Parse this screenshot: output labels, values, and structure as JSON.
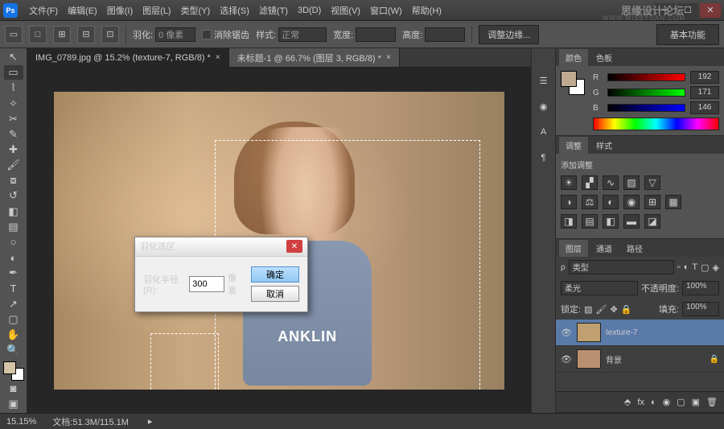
{
  "watermark": {
    "line1": "思缘设计论坛",
    "line2": "WWW.MISSYUAN.COM"
  },
  "menu": {
    "file": "文件(F)",
    "edit": "编辑(E)",
    "image": "图像(I)",
    "layer": "图层(L)",
    "type": "类型(Y)",
    "select": "选择(S)",
    "filter": "滤镜(T)",
    "3d": "3D(D)",
    "view": "视图(V)",
    "window": "窗口(W)",
    "help": "帮助(H)"
  },
  "options": {
    "feather_label": "羽化:",
    "feather_value": "0 像素",
    "antialias": "消除锯齿",
    "style_label": "样式:",
    "style_value": "正常",
    "width_label": "宽度:",
    "height_label": "高度:",
    "refine": "调整边缘...",
    "workspace": "基本功能"
  },
  "tabs": [
    {
      "label": "IMG_0789.jpg @ 15.2% (texture-7, RGB/8) *",
      "active": true
    },
    {
      "label": "未标题-1 @ 66.7% (图层 3, RGB/8) *",
      "active": false
    }
  ],
  "dialog": {
    "title": "羽化选区",
    "radius_label": "羽化半径(R):",
    "radius_value": "300",
    "unit": "像素",
    "ok": "确定",
    "cancel": "取消"
  },
  "vest_text": "ANKLIN",
  "panels": {
    "color": {
      "tab1": "颜色",
      "tab2": "色板",
      "r": "R",
      "g": "G",
      "b": "B",
      "r_val": "192",
      "g_val": "171",
      "b_val": "146"
    },
    "adjust": {
      "tab1": "调整",
      "tab2": "样式",
      "title": "添加调整"
    },
    "layers": {
      "tab1": "图层",
      "tab2": "通道",
      "tab3": "路径",
      "kind": "类型",
      "blend": "柔光",
      "opacity_label": "不透明度:",
      "opacity": "100%",
      "lock_label": "锁定:",
      "fill_label": "填充:",
      "fill": "100%",
      "items": [
        {
          "name": "texture-7",
          "active": true,
          "locked": false
        },
        {
          "name": "背景",
          "active": false,
          "locked": true
        }
      ]
    }
  },
  "status": {
    "zoom": "15.15%",
    "doc": "文档:51.3M/115.1M"
  }
}
